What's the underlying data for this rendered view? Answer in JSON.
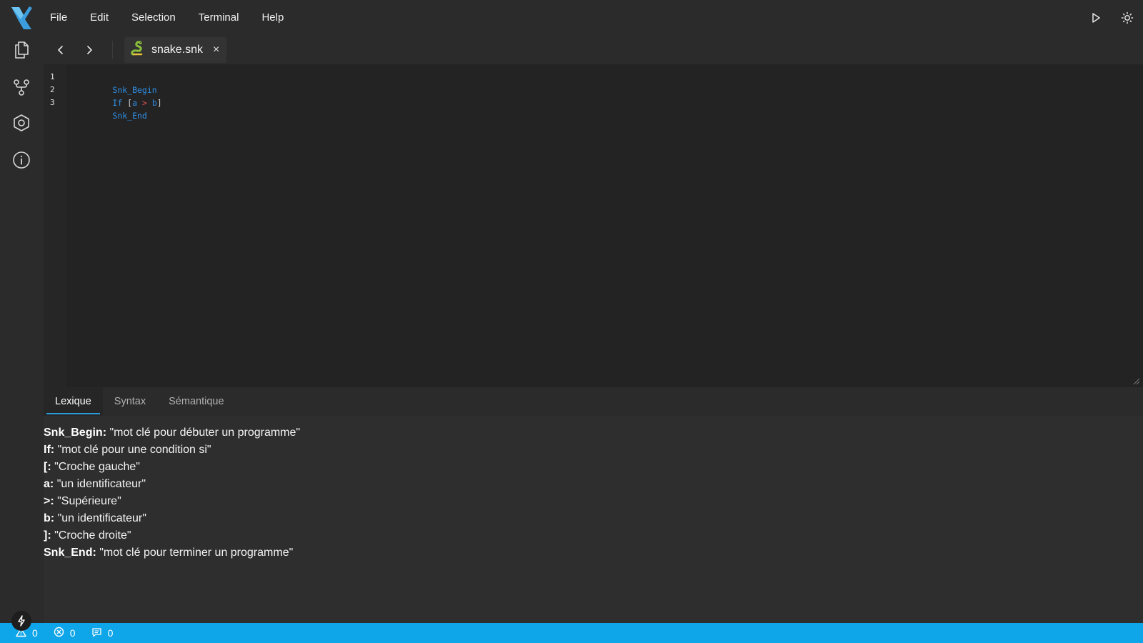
{
  "menu": [
    "File",
    "Edit",
    "Selection",
    "Terminal",
    "Help"
  ],
  "icons": {
    "logo": "brand-x-icon",
    "run": "play-icon",
    "theme": "sun-icon",
    "explorer": "files-icon",
    "source_control": "git-branch-icon",
    "settings": "hexagon-icon",
    "info": "info-icon",
    "back": "chevron-left-icon",
    "forward": "chevron-right-icon",
    "file_type": "snake-icon",
    "close": "close-icon",
    "bolt": "bolt-icon",
    "warning": "warning-icon",
    "error": "error-icon",
    "message": "message-icon"
  },
  "colors": {
    "accent": "#0ea5e9",
    "keyword": "#2f8fe6",
    "operator": "#e0505a",
    "logo": "#3b9ddd"
  },
  "tab": {
    "label": "snake.snk",
    "close": "×"
  },
  "editor": {
    "line_numbers": [
      "1",
      "2",
      "3"
    ],
    "lines": [
      {
        "tokens": [
          {
            "text": "Snk_Begin",
            "kind": "kw"
          }
        ]
      },
      {
        "tokens": [
          {
            "text": "If",
            "kind": "kw"
          },
          {
            "text": " [",
            "kind": "br"
          },
          {
            "text": "a",
            "kind": "id"
          },
          {
            "text": " > ",
            "kind": "op"
          },
          {
            "text": "b",
            "kind": "id"
          },
          {
            "text": "]",
            "kind": "br"
          }
        ]
      },
      {
        "tokens": [
          {
            "text": "Snk_End",
            "kind": "kw"
          }
        ]
      }
    ]
  },
  "panel": {
    "tabs": [
      {
        "label": "Lexique",
        "active": true
      },
      {
        "label": "Syntax",
        "active": false
      },
      {
        "label": "Sémantique",
        "active": false
      }
    ],
    "lexique": [
      {
        "token": "Snk_Begin:",
        "desc": "\"mot clé pour débuter un programme\""
      },
      {
        "token": "If:",
        "desc": "\"mot clé pour une condition si\""
      },
      {
        "token": "[:",
        "desc": "\"Croche gauche\""
      },
      {
        "token": "a:",
        "desc": "\"un identificateur\""
      },
      {
        "token": ">:",
        "desc": "\"Supérieure\""
      },
      {
        "token": "b:",
        "desc": "\"un identificateur\""
      },
      {
        "token": "]:",
        "desc": "\"Croche droite\""
      },
      {
        "token": "Snk_End:",
        "desc": "\"mot clé pour terminer un programme\""
      }
    ]
  },
  "status": {
    "warnings": "0",
    "errors": "0",
    "messages": "0"
  }
}
